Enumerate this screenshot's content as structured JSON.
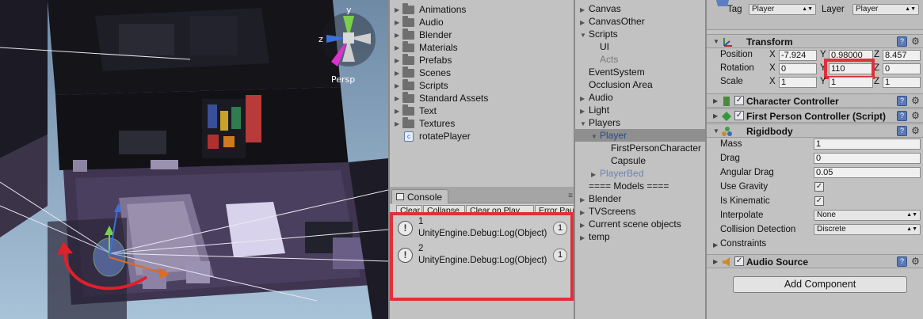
{
  "scene": {
    "persp_label": "Persp",
    "gizmo_axes": {
      "x": "x",
      "y": "y",
      "z": "z"
    }
  },
  "project": {
    "items": [
      {
        "label": "Animations",
        "type": "folder"
      },
      {
        "label": "Audio",
        "type": "folder"
      },
      {
        "label": "Blender",
        "type": "folder"
      },
      {
        "label": "Materials",
        "type": "folder"
      },
      {
        "label": "Prefabs",
        "type": "folder"
      },
      {
        "label": "Scenes",
        "type": "folder"
      },
      {
        "label": "Scripts",
        "type": "folder"
      },
      {
        "label": "Standard Assets",
        "type": "folder"
      },
      {
        "label": "Text",
        "type": "folder"
      },
      {
        "label": "Textures",
        "type": "folder"
      },
      {
        "label": "rotatePlayer",
        "type": "script"
      }
    ]
  },
  "console": {
    "tab_label": "Console",
    "menu_glyph": "≡",
    "buttons": [
      "Clear",
      "Collapse",
      "Clear on Play",
      "Error Pau"
    ],
    "entries": [
      {
        "value": "1",
        "message": "UnityEngine.Debug:Log(Object)",
        "count": "1"
      },
      {
        "value": "2",
        "message": "UnityEngine.Debug:Log(Object)",
        "count": "1"
      }
    ]
  },
  "hierarchy": {
    "items": [
      {
        "label": "Canvas",
        "indent": 0,
        "arrow": "right"
      },
      {
        "label": "CanvasOther",
        "indent": 0,
        "arrow": "right"
      },
      {
        "label": "Scripts",
        "indent": 0,
        "arrow": "down"
      },
      {
        "label": "UI",
        "indent": 1,
        "arrow": ""
      },
      {
        "label": "Acts",
        "indent": 1,
        "arrow": "",
        "dim": true
      },
      {
        "label": "EventSystem",
        "indent": 0,
        "arrow": ""
      },
      {
        "label": "Occlusion Area",
        "indent": 0,
        "arrow": ""
      },
      {
        "label": "Audio",
        "indent": 0,
        "arrow": "right"
      },
      {
        "label": "Light",
        "indent": 0,
        "arrow": "right"
      },
      {
        "label": "Players",
        "indent": 0,
        "arrow": "down"
      },
      {
        "label": "Player",
        "indent": 1,
        "arrow": "down",
        "prefab": true,
        "selected": true
      },
      {
        "label": "FirstPersonCharacter",
        "indent": 2,
        "arrow": ""
      },
      {
        "label": "Capsule",
        "indent": 2,
        "arrow": ""
      },
      {
        "label": "PlayerBed",
        "indent": 1,
        "arrow": "right",
        "prefab": true,
        "dim": true
      },
      {
        "label": "==== Models ====",
        "indent": 0,
        "arrow": ""
      },
      {
        "label": "Blender",
        "indent": 0,
        "arrow": "right"
      },
      {
        "label": "TVScreens",
        "indent": 0,
        "arrow": "right"
      },
      {
        "label": "Current scene objects",
        "indent": 0,
        "arrow": "right"
      },
      {
        "label": "temp",
        "indent": 0,
        "arrow": "right"
      }
    ]
  },
  "inspector": {
    "tag_label": "Tag",
    "tag_value": "Player",
    "layer_label": "Layer",
    "layer_value": "Player",
    "transform": {
      "title": "Transform",
      "position_label": "Position",
      "rotation_label": "Rotation",
      "scale_label": "Scale",
      "axis_x": "X",
      "axis_y": "Y",
      "axis_z": "Z",
      "position": {
        "x": "-7.924",
        "y": "0.98000",
        "z": "8.457"
      },
      "rotation": {
        "x": "0",
        "y": "110",
        "z": "0"
      },
      "scale": {
        "x": "1",
        "y": "1",
        "z": "1"
      }
    },
    "character_controller": {
      "title": "Character Controller"
    },
    "fps_controller": {
      "title": "First Person Controller (Script)"
    },
    "rigidbody": {
      "title": "Rigidbody",
      "mass_label": "Mass",
      "mass": "1",
      "drag_label": "Drag",
      "drag": "0",
      "angular_drag_label": "Angular Drag",
      "angular_drag": "0.05",
      "use_gravity_label": "Use Gravity",
      "use_gravity": true,
      "is_kinematic_label": "Is Kinematic",
      "is_kinematic": true,
      "interpolate_label": "Interpolate",
      "interpolate": "None",
      "collision_label": "Collision Detection",
      "collision": "Discrete",
      "constraints_label": "Constraints"
    },
    "audio_source": {
      "title": "Audio Source"
    },
    "add_component": "Add Component"
  },
  "colors": {
    "highlight": "#e0303a",
    "selection": "#8f8f8f",
    "panel": "#c2c2c2"
  }
}
